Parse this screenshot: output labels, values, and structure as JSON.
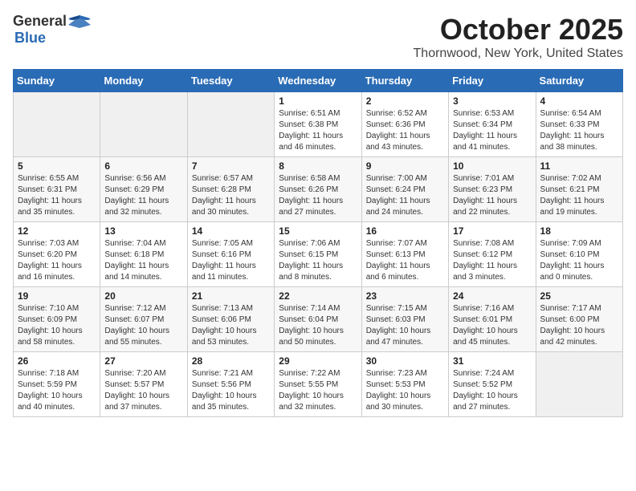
{
  "logo": {
    "general": "General",
    "blue": "Blue"
  },
  "title": "October 2025",
  "subtitle": "Thornwood, New York, United States",
  "days_of_week": [
    "Sunday",
    "Monday",
    "Tuesday",
    "Wednesday",
    "Thursday",
    "Friday",
    "Saturday"
  ],
  "weeks": [
    [
      {
        "day": "",
        "info": ""
      },
      {
        "day": "",
        "info": ""
      },
      {
        "day": "",
        "info": ""
      },
      {
        "day": "1",
        "info": "Sunrise: 6:51 AM\nSunset: 6:38 PM\nDaylight: 11 hours\nand 46 minutes."
      },
      {
        "day": "2",
        "info": "Sunrise: 6:52 AM\nSunset: 6:36 PM\nDaylight: 11 hours\nand 43 minutes."
      },
      {
        "day": "3",
        "info": "Sunrise: 6:53 AM\nSunset: 6:34 PM\nDaylight: 11 hours\nand 41 minutes."
      },
      {
        "day": "4",
        "info": "Sunrise: 6:54 AM\nSunset: 6:33 PM\nDaylight: 11 hours\nand 38 minutes."
      }
    ],
    [
      {
        "day": "5",
        "info": "Sunrise: 6:55 AM\nSunset: 6:31 PM\nDaylight: 11 hours\nand 35 minutes."
      },
      {
        "day": "6",
        "info": "Sunrise: 6:56 AM\nSunset: 6:29 PM\nDaylight: 11 hours\nand 32 minutes."
      },
      {
        "day": "7",
        "info": "Sunrise: 6:57 AM\nSunset: 6:28 PM\nDaylight: 11 hours\nand 30 minutes."
      },
      {
        "day": "8",
        "info": "Sunrise: 6:58 AM\nSunset: 6:26 PM\nDaylight: 11 hours\nand 27 minutes."
      },
      {
        "day": "9",
        "info": "Sunrise: 7:00 AM\nSunset: 6:24 PM\nDaylight: 11 hours\nand 24 minutes."
      },
      {
        "day": "10",
        "info": "Sunrise: 7:01 AM\nSunset: 6:23 PM\nDaylight: 11 hours\nand 22 minutes."
      },
      {
        "day": "11",
        "info": "Sunrise: 7:02 AM\nSunset: 6:21 PM\nDaylight: 11 hours\nand 19 minutes."
      }
    ],
    [
      {
        "day": "12",
        "info": "Sunrise: 7:03 AM\nSunset: 6:20 PM\nDaylight: 11 hours\nand 16 minutes."
      },
      {
        "day": "13",
        "info": "Sunrise: 7:04 AM\nSunset: 6:18 PM\nDaylight: 11 hours\nand 14 minutes."
      },
      {
        "day": "14",
        "info": "Sunrise: 7:05 AM\nSunset: 6:16 PM\nDaylight: 11 hours\nand 11 minutes."
      },
      {
        "day": "15",
        "info": "Sunrise: 7:06 AM\nSunset: 6:15 PM\nDaylight: 11 hours\nand 8 minutes."
      },
      {
        "day": "16",
        "info": "Sunrise: 7:07 AM\nSunset: 6:13 PM\nDaylight: 11 hours\nand 6 minutes."
      },
      {
        "day": "17",
        "info": "Sunrise: 7:08 AM\nSunset: 6:12 PM\nDaylight: 11 hours\nand 3 minutes."
      },
      {
        "day": "18",
        "info": "Sunrise: 7:09 AM\nSunset: 6:10 PM\nDaylight: 11 hours\nand 0 minutes."
      }
    ],
    [
      {
        "day": "19",
        "info": "Sunrise: 7:10 AM\nSunset: 6:09 PM\nDaylight: 10 hours\nand 58 minutes."
      },
      {
        "day": "20",
        "info": "Sunrise: 7:12 AM\nSunset: 6:07 PM\nDaylight: 10 hours\nand 55 minutes."
      },
      {
        "day": "21",
        "info": "Sunrise: 7:13 AM\nSunset: 6:06 PM\nDaylight: 10 hours\nand 53 minutes."
      },
      {
        "day": "22",
        "info": "Sunrise: 7:14 AM\nSunset: 6:04 PM\nDaylight: 10 hours\nand 50 minutes."
      },
      {
        "day": "23",
        "info": "Sunrise: 7:15 AM\nSunset: 6:03 PM\nDaylight: 10 hours\nand 47 minutes."
      },
      {
        "day": "24",
        "info": "Sunrise: 7:16 AM\nSunset: 6:01 PM\nDaylight: 10 hours\nand 45 minutes."
      },
      {
        "day": "25",
        "info": "Sunrise: 7:17 AM\nSunset: 6:00 PM\nDaylight: 10 hours\nand 42 minutes."
      }
    ],
    [
      {
        "day": "26",
        "info": "Sunrise: 7:18 AM\nSunset: 5:59 PM\nDaylight: 10 hours\nand 40 minutes."
      },
      {
        "day": "27",
        "info": "Sunrise: 7:20 AM\nSunset: 5:57 PM\nDaylight: 10 hours\nand 37 minutes."
      },
      {
        "day": "28",
        "info": "Sunrise: 7:21 AM\nSunset: 5:56 PM\nDaylight: 10 hours\nand 35 minutes."
      },
      {
        "day": "29",
        "info": "Sunrise: 7:22 AM\nSunset: 5:55 PM\nDaylight: 10 hours\nand 32 minutes."
      },
      {
        "day": "30",
        "info": "Sunrise: 7:23 AM\nSunset: 5:53 PM\nDaylight: 10 hours\nand 30 minutes."
      },
      {
        "day": "31",
        "info": "Sunrise: 7:24 AM\nSunset: 5:52 PM\nDaylight: 10 hours\nand 27 minutes."
      },
      {
        "day": "",
        "info": ""
      }
    ]
  ]
}
